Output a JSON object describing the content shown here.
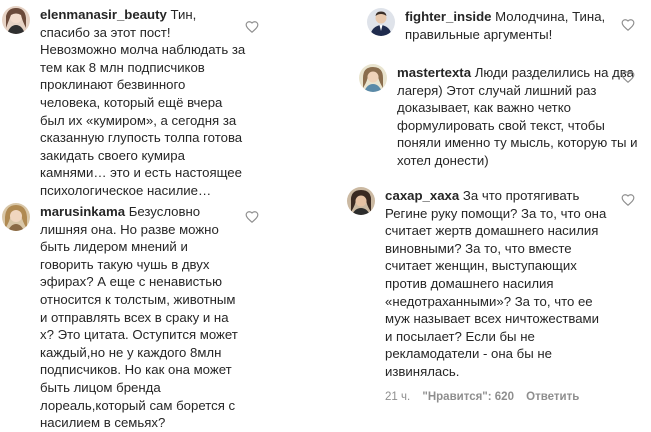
{
  "left": {
    "comments": [
      {
        "username": "elenmanasir_beauty",
        "text": "Тин, спасибо за этот пост! Невозможно молча наблюдать за тем как 8 млн подписчиков проклинают безвинного человека, который ещё вчера был их «кумиром», а сегодня за сказанную глупость толпа готова закидать своего кумира камнями… это и есть настоящее психологическое насилие…",
        "avatar_icon": "avatar-photo-icon"
      },
      {
        "username": "marusinkama",
        "text": "Безусловно лишняя она. Но разве можно быть лидером мнений и говорить такую чушь в двух эфирах? А еще с ненавистью относится к толстым, животным и отправлять всех в сраку и на х? Это цитата. Оступится может каждый,но не у каждого 8млн подписчиков. Но как она может быть лицом бренда лореаль,который сам борется с насилием в семьях?",
        "avatar_icon": "avatar-photo-icon"
      }
    ]
  },
  "right": {
    "comments": [
      {
        "username": "fighter_inside",
        "text": "Молодчина, Тина, правильные аргументы!",
        "avatar_icon": "avatar-photo-icon"
      },
      {
        "username": "mastertexta",
        "text": "Люди разделились на два лагеря) Этот случай лишний раз доказывает, как важно четко формулировать свой текст, чтобы поняли именно ту мысль, которую ты и хотел донести)",
        "avatar_icon": "avatar-photo-icon"
      },
      {
        "username": "сахар_хаха",
        "text": "За что протягивать Регине руку помощи? За то, что она считает жертв домашнего насилия виновными? За то, что вместе считает женщин, выступающих против домашнего насилия «недотраханными»? За то, что ее муж называет всех ничтожествами и посылает? Если бы не рекламодатели - она бы не извинялась.",
        "avatar_icon": "avatar-photo-icon",
        "time": "21 ч.",
        "likes": "\"Нравится\": 620",
        "reply": "Ответить"
      }
    ]
  },
  "colors": {
    "text": "#262626",
    "meta": "#8e8e8e",
    "heart": "#8e8e8e"
  }
}
